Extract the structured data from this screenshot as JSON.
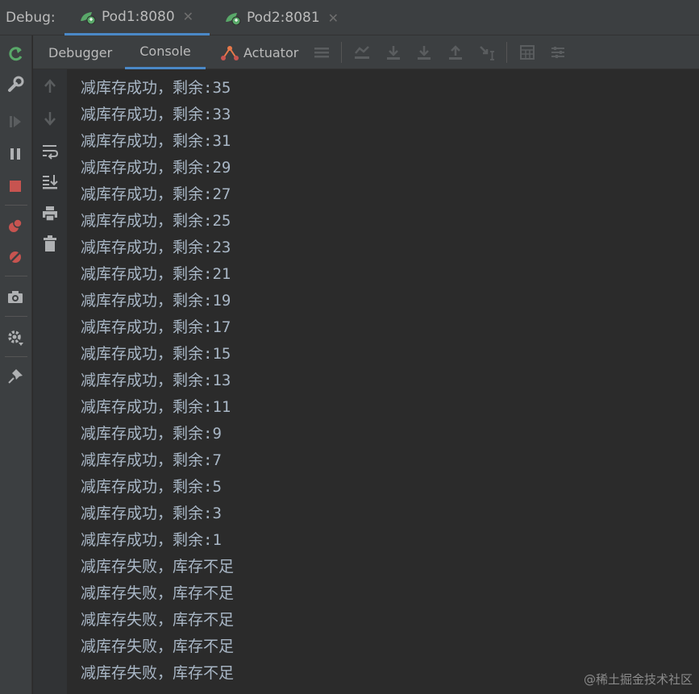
{
  "debug_label": "Debug:",
  "run_tabs": [
    {
      "label": "Pod1:8080",
      "active": true
    },
    {
      "label": "Pod2:8081",
      "active": false
    }
  ],
  "sub_tabs": {
    "debugger": "Debugger",
    "console": "Console",
    "actuator": "Actuator"
  },
  "console_lines": [
    "减库存成功，剩余:35",
    "减库存成功，剩余:33",
    "减库存成功，剩余:31",
    "减库存成功，剩余:29",
    "减库存成功，剩余:27",
    "减库存成功，剩余:25",
    "减库存成功，剩余:23",
    "减库存成功，剩余:21",
    "减库存成功，剩余:19",
    "减库存成功，剩余:17",
    "减库存成功，剩余:15",
    "减库存成功，剩余:13",
    "减库存成功，剩余:11",
    "减库存成功，剩余:9",
    "减库存成功，剩余:7",
    "减库存成功，剩余:5",
    "减库存成功，剩余:3",
    "减库存成功，剩余:1",
    "减库存失败，库存不足",
    "减库存失败，库存不足",
    "减库存失败，库存不足",
    "减库存失败，库存不足",
    "减库存失败，库存不足"
  ],
  "watermark": "@稀土掘金技术社区",
  "colors": {
    "background": "#2b2b2b",
    "toolbar": "#3c3f41",
    "accent": "#4a88c7",
    "text": "#a9b7c6",
    "green": "#59a869",
    "red": "#c75450"
  }
}
